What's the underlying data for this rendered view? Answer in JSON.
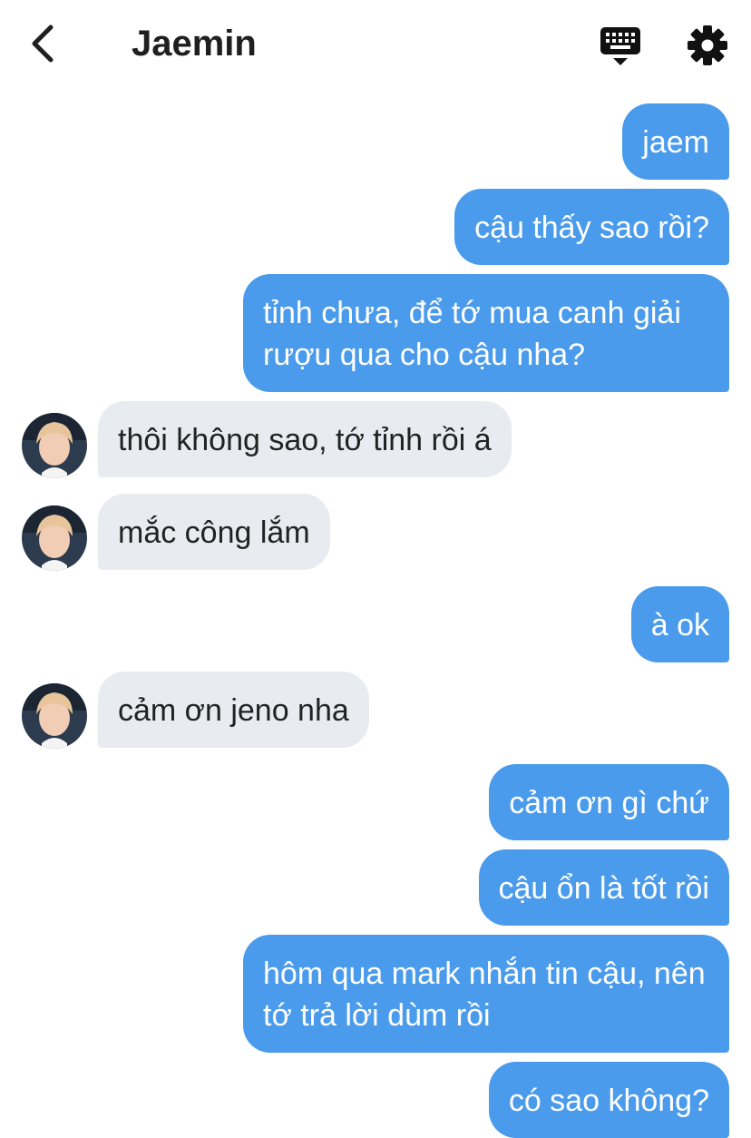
{
  "header": {
    "title": "Jaemin"
  },
  "icons": {
    "back": "chevron-left-icon",
    "keyboard": "keyboard-icon",
    "settings": "gear-icon"
  },
  "colors": {
    "outgoing_bubble": "#4a9beb",
    "incoming_bubble": "#e8ecf0",
    "text_dark": "#1f1f1f"
  },
  "messages": [
    {
      "sender": "me",
      "text": "jaem"
    },
    {
      "sender": "me",
      "text": "cậu thấy sao rồi?"
    },
    {
      "sender": "me",
      "text": "tỉnh chưa, để tớ mua canh giải rượu qua cho cậu nha?"
    },
    {
      "sender": "Jaemin",
      "text": "thôi không sao, tớ tỉnh rồi á"
    },
    {
      "sender": "Jaemin",
      "text": "mắc công lắm"
    },
    {
      "sender": "me",
      "text": "à ok"
    },
    {
      "sender": "Jaemin",
      "text": "cảm ơn jeno nha"
    },
    {
      "sender": "me",
      "text": "cảm ơn gì chứ"
    },
    {
      "sender": "me",
      "text": "cậu ổn là tốt rồi"
    },
    {
      "sender": "me",
      "text": "hôm qua mark nhắn tin cậu, nên tớ trả lời dùm rồi"
    },
    {
      "sender": "me",
      "text": "có sao không?"
    }
  ]
}
